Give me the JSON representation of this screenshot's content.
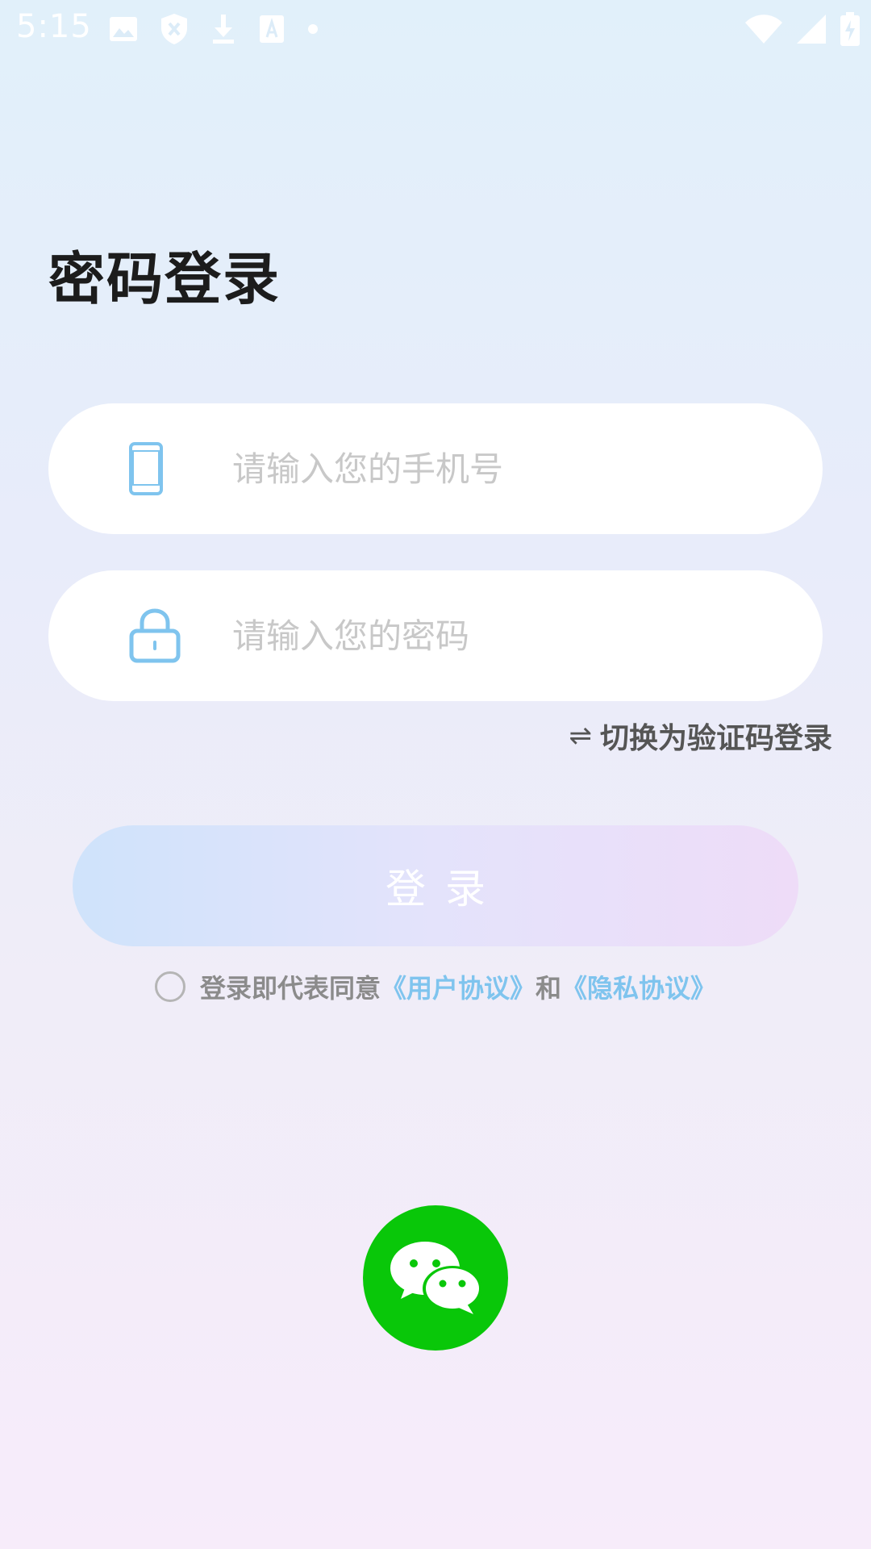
{
  "status_bar": {
    "time": "5:15",
    "left_icons": [
      "image-icon",
      "shield-icon",
      "download-icon",
      "text-icon",
      "dot-icon"
    ],
    "right_icons": [
      "wifi-icon",
      "signal-icon",
      "battery-charging-icon"
    ]
  },
  "page": {
    "title": "密码登录"
  },
  "form": {
    "phone_placeholder": "请输入您的手机号",
    "phone_icon": "phone-icon",
    "password_placeholder": "请输入您的密码",
    "password_icon": "lock-icon",
    "switch_icon": "⇌",
    "switch_label": "切换为验证码登录",
    "login_label": "登录"
  },
  "agreement": {
    "prefix": "登录即代表同意",
    "user_agreement": "《用户协议》",
    "joiner": "和",
    "privacy_agreement": "《隐私协议》",
    "checked": false
  },
  "social": {
    "wechat_icon": "wechat-icon"
  },
  "colors": {
    "accent_blue": "#7fc4ee",
    "wechat_green": "#09c709",
    "title": "#1c1c1c",
    "placeholder": "#c8c8c8"
  }
}
